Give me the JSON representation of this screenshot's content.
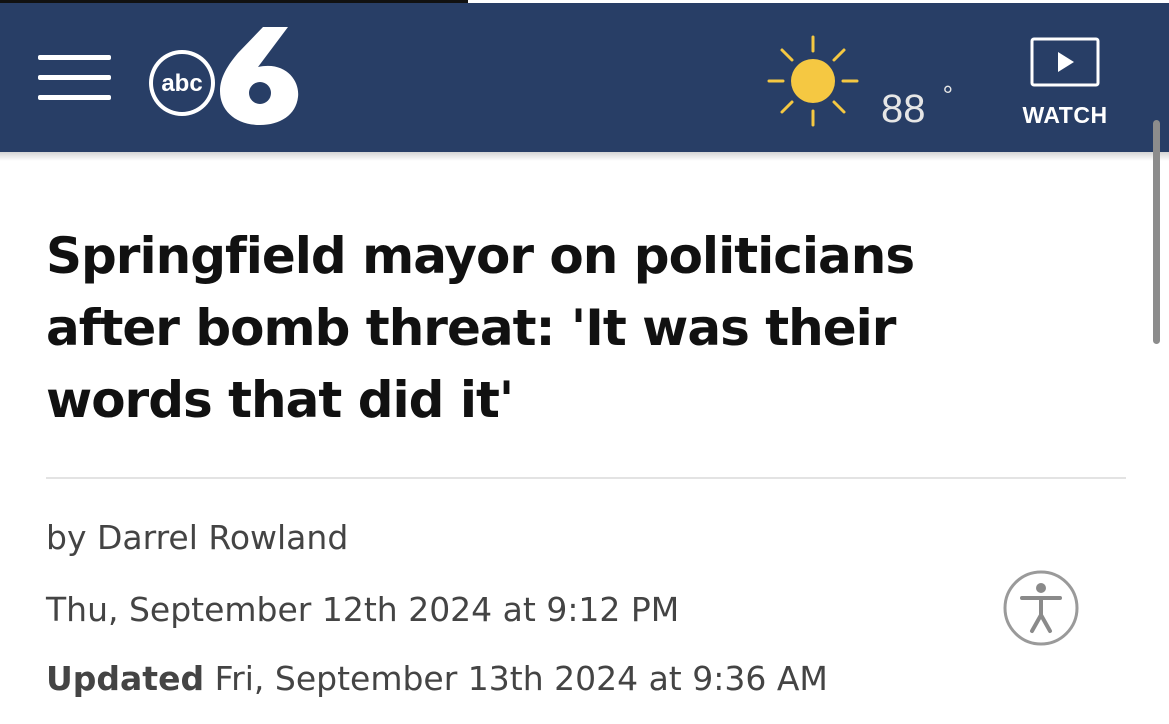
{
  "header": {
    "logo": {
      "network": "abc",
      "channel": "6"
    },
    "weather": {
      "temperature": "88",
      "unit": "°",
      "icon": "sun-icon"
    },
    "watch_label": "WATCH",
    "menu_icon": "hamburger-menu-icon"
  },
  "article": {
    "headline": "Springfield mayor on politicians after bomb threat: 'It was their words that did it'",
    "byline": "by Darrel Rowland",
    "published": "Thu, September 12th 2024 at 9:12 PM",
    "updated_label": "Updated",
    "updated": "Fri, September 13th 2024 at 9:36 AM"
  },
  "accessibility_icon": "accessibility-icon",
  "colors": {
    "header_bg": "#283e66",
    "sun": "#f5c842",
    "text": "#111111",
    "meta_text": "#444444"
  }
}
